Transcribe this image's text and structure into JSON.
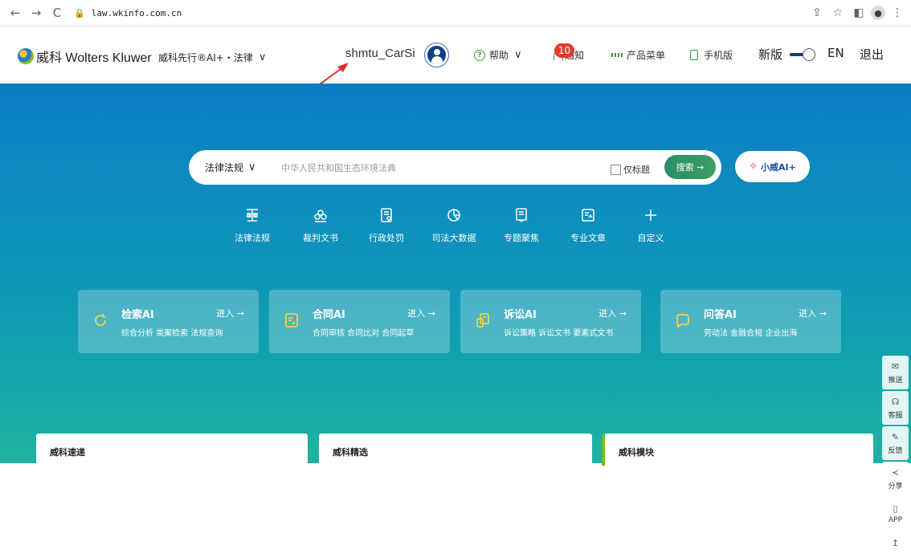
{
  "browser": {
    "url": "law.wkinfo.com.cn",
    "back_icon": "←",
    "forward_icon": "→",
    "reload_icon": "C",
    "share_icon": "⇪",
    "star_icon": "☆",
    "sidebar_icon": "◧",
    "menu_icon": "⋮"
  },
  "header": {
    "logo_text": "威科 Wolters Kluwer",
    "product": "威科先行®AI+・法律",
    "username": "shmtu_CarSi",
    "help": "帮助",
    "notify_count": "10",
    "notify": "通知",
    "product_menu": "产品菜单",
    "mobile": "手机版",
    "new_version": "新版",
    "lang": "EN",
    "logout": "退出"
  },
  "search": {
    "scope": "法律法规",
    "placeholder": "中华人民共和国生态环境法典",
    "title_only": "仅标题",
    "button": "搜索 →",
    "ai_button": "小威AI+"
  },
  "quick_links": [
    {
      "label": "法律法规",
      "icon": "scales-icon"
    },
    {
      "label": "裁判文书",
      "icon": "gavel-icon"
    },
    {
      "label": "行政处罚",
      "icon": "document-icon"
    },
    {
      "label": "司法大数据",
      "icon": "pie-chart-icon"
    },
    {
      "label": "专题聚焦",
      "icon": "book-icon"
    },
    {
      "label": "专业文章",
      "icon": "article-icon"
    },
    {
      "label": "自定义",
      "icon": "plus-icon"
    }
  ],
  "ai_cards": [
    {
      "title": "检索AI",
      "enter": "进入 →",
      "sub": "综合分析  类案检索  法规查询"
    },
    {
      "title": "合同AI",
      "enter": "进入 →",
      "sub": "合同审核  合同比对  合同起草"
    },
    {
      "title": "诉讼AI",
      "enter": "进入 →",
      "sub": "诉讼策略  诉讼文书  要素式文书"
    },
    {
      "title": "问答AI",
      "enter": "进入 →",
      "sub": "劳动法  金融合规  企业出海"
    }
  ],
  "bottom_cards": [
    "威科速递",
    "威科精选",
    "威科模块"
  ],
  "side_tools": [
    {
      "label": "推送",
      "icon": "✉"
    },
    {
      "label": "客服",
      "icon": "☊"
    },
    {
      "label": "反馈",
      "icon": "✎"
    },
    {
      "label": "分享",
      "icon": "≺"
    },
    {
      "label": "APP",
      "icon": "▯"
    },
    {
      "label": "",
      "icon": "↥"
    }
  ],
  "colors": {
    "accent_green": "#2f9a3f",
    "brand_blue": "#0c3f87",
    "badge_red": "#e23b2e"
  }
}
